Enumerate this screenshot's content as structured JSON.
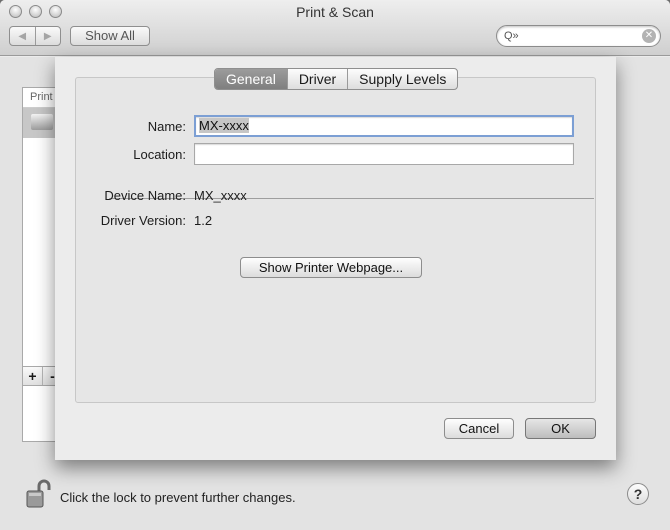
{
  "window": {
    "title": "Print & Scan",
    "nav_back": "◀",
    "nav_forward": "▶",
    "show_all": "Show All",
    "search_icon": "Q»",
    "search_clear": "✕"
  },
  "printer_list": {
    "header": "Print",
    "add": "+",
    "remove": "-"
  },
  "footer": {
    "lock_text": "Click the lock to prevent further changes.",
    "help": "?"
  },
  "sheet": {
    "tabs": [
      {
        "label": "General",
        "active": true
      },
      {
        "label": "Driver",
        "active": false
      },
      {
        "label": "Supply Levels",
        "active": false
      }
    ],
    "name_label": "Name:",
    "name_value": "MX-xxxx",
    "location_label": "Location:",
    "location_value": "",
    "device_name_label": "Device Name:",
    "device_name_value": "MX_xxxx",
    "driver_version_label": "Driver Version:",
    "driver_version_value": "1.2",
    "webpage_button": "Show Printer Webpage...",
    "cancel_button": "Cancel",
    "ok_button": "OK"
  },
  "colors": {
    "focus_ring": "#7c9fd4",
    "active_tab": "#8a8a8a"
  },
  "icons": {
    "lock": "padlock-open-icon",
    "search": "magnifier-icon",
    "printer": "printer-icon"
  }
}
